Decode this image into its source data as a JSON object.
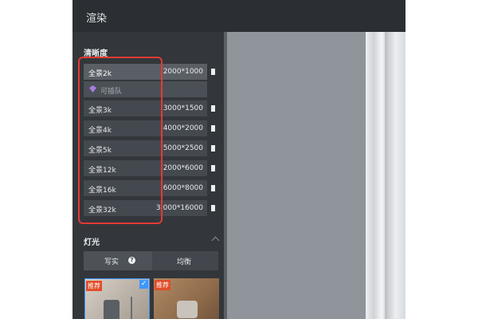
{
  "panel": {
    "title": "渲染"
  },
  "resolution": {
    "section_title": "清晰度",
    "options": [
      {
        "name": "全景2k",
        "res": "2000*1000",
        "selected": true
      },
      {
        "name": "全景3k",
        "res": "3000*1500"
      },
      {
        "name": "全景4k",
        "res": "4000*2000"
      },
      {
        "name": "全景5k",
        "res": "5000*2500"
      },
      {
        "name": "全景12k",
        "res": "2000*6000"
      },
      {
        "name": "全景16k",
        "res": "6000*8000"
      },
      {
        "name": "全景32k",
        "res": "3:000*16000"
      }
    ],
    "sub_label": "可插队",
    "sub_icon": "diamond-icon"
  },
  "lighting": {
    "section_title": "灯光",
    "tabs": [
      {
        "label": "写实",
        "active": true
      },
      {
        "label": "均衡",
        "active": false
      }
    ],
    "presets": [
      {
        "badge": "推荐",
        "selected": true
      },
      {
        "badge": "推荐",
        "selected": false
      }
    ]
  },
  "colors": {
    "panel_bg": "#33373b",
    "highlight": "#e53935",
    "accent": "#3d97ff",
    "diamond": "#a77de0"
  }
}
